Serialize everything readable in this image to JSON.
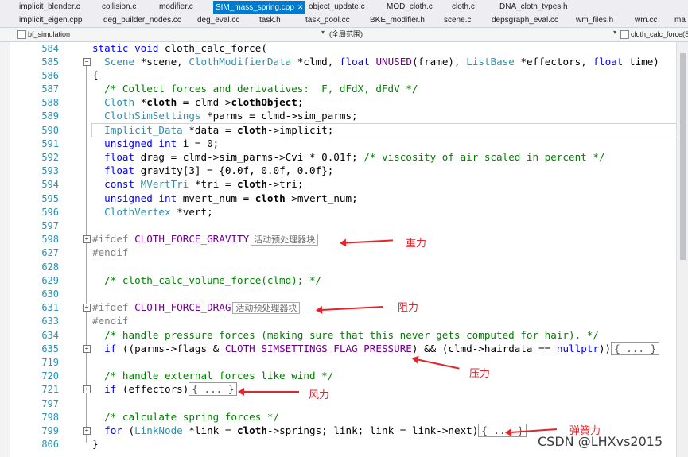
{
  "tabs_row1": [
    "implicit_blender.c",
    "collision.c",
    "modifier.c",
    "SIM_mass_spring.cpp",
    "object_update.c",
    "MOD_cloth.c",
    "cloth.c",
    "DNA_cloth_types.h"
  ],
  "tabs_row2": [
    "implicit_eigen.cpp",
    "deg_builder_nodes.cc",
    "deg_eval.cc",
    "task.h",
    "task_pool.cc",
    "BKE_modifier.h",
    "scene.c",
    "depsgraph_eval.cc",
    "wm_files.h",
    "wm.cc",
    "ma"
  ],
  "navbar": {
    "project": "bf_simulation",
    "scope": "(全局范围)",
    "function": "cloth_calc_force(Sce"
  },
  "line_numbers": [
    "584",
    "585",
    "586",
    "587",
    "588",
    "589",
    "590",
    "591",
    "592",
    "593",
    "594",
    "595",
    "596",
    "597",
    "598",
    "627",
    "628",
    "629",
    "630",
    "631",
    "633",
    "634",
    "635",
    "719",
    "720",
    "721",
    "797",
    "798",
    "799",
    "806"
  ],
  "code": {
    "l584": "static void cloth_calc_force(",
    "l585": "  Scene *scene, ClothModifierData *clmd, float UNUSED(frame), ListBase *effectors, float time)",
    "l586": "{",
    "l587": "  /* Collect forces and derivatives:  F, dFdX, dFdV */",
    "l588": "  Cloth *cloth = clmd->clothObject;",
    "l589": "  ClothSimSettings *parms = clmd->sim_parms;",
    "l590": "  Implicit_Data *data = cloth->implicit;",
    "l591": "  unsigned int i = 0;",
    "l592": "  float drag = clmd->sim_parms->Cvi * 0.01f; /* viscosity of air scaled in percent */",
    "l593": "  float gravity[3] = {0.0f, 0.0f, 0.0f};",
    "l594": "  const MVertTri *tri = cloth->tri;",
    "l595": "  unsigned int mvert_num = cloth->mvert_num;",
    "l596": "  ClothVertex *vert;",
    "l598": "#ifdef CLOTH_FORCE_GRAVITY",
    "l627": "#endif",
    "l629": "  /* cloth_calc_volume_force(clmd); */",
    "l631": "#ifdef CLOTH_FORCE_DRAG",
    "l633": "#endif",
    "l634": "  /* handle pressure forces (making sure that this never gets computed for hair). */",
    "l635": "  if ((parms->flags & CLOTH_SIMSETTINGS_FLAG_PRESSURE) && (clmd->hairdata == nullptr))",
    "l720": "  /* handle external forces like wind */",
    "l721": "  if (effectors)",
    "l798": "  /* calculate spring forces */",
    "l799": "  for (LinkNode *link = cloth->springs; link; link = link->next)",
    "l806": "}"
  },
  "collapsed_marker": "{ ... }",
  "preproc_hint": "活动预处理器块",
  "annotations": {
    "gravity": "重力",
    "drag": "阻力",
    "pressure": "压力",
    "wind": "风力",
    "spring": "弹簧力"
  },
  "watermark": "CSDN @LHXvs2015"
}
